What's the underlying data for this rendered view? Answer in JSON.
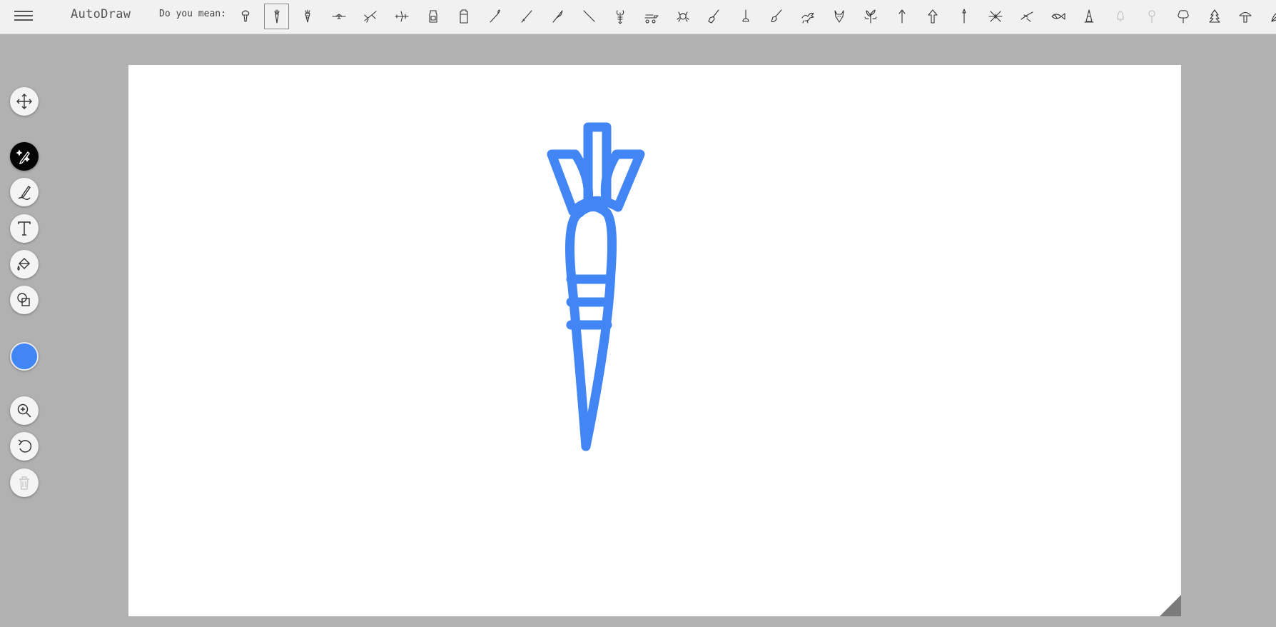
{
  "app": {
    "title": "AutoDraw"
  },
  "suggestions": {
    "label": "Do you mean:",
    "items": [
      "broccoli",
      "carrot",
      "carrot-alt",
      "airplane-front",
      "airplane",
      "airplane-side",
      "jar",
      "battery",
      "match",
      "sword",
      "knife",
      "wand",
      "lobster",
      "truck",
      "crab",
      "broom",
      "plunger",
      "paintbrush",
      "dragon",
      "wolf-head",
      "plant",
      "arrow",
      "arrow-up",
      "spear",
      "spider",
      "bird",
      "fish",
      "traffic-cone",
      "bell",
      "lollipop",
      "tree",
      "pine-tree",
      "mushroom",
      "leaf"
    ],
    "selected_index": 1
  },
  "tools": [
    {
      "name": "move-tool",
      "label": "Select"
    },
    {
      "name": "autodraw-tool",
      "label": "AutoDraw"
    },
    {
      "name": "draw-tool",
      "label": "Draw"
    },
    {
      "name": "text-tool",
      "label": "Type"
    },
    {
      "name": "fill-tool",
      "label": "Fill"
    },
    {
      "name": "shape-tool",
      "label": "Shape"
    },
    {
      "name": "zoom-tool",
      "label": "Zoom"
    },
    {
      "name": "undo-tool",
      "label": "Undo"
    },
    {
      "name": "delete-tool",
      "label": "Delete"
    }
  ],
  "active_tool": "autodraw-tool",
  "color": {
    "current": "#4285f4"
  },
  "drawing": {
    "subject": "carrot",
    "stroke_color": "#4285f4"
  }
}
